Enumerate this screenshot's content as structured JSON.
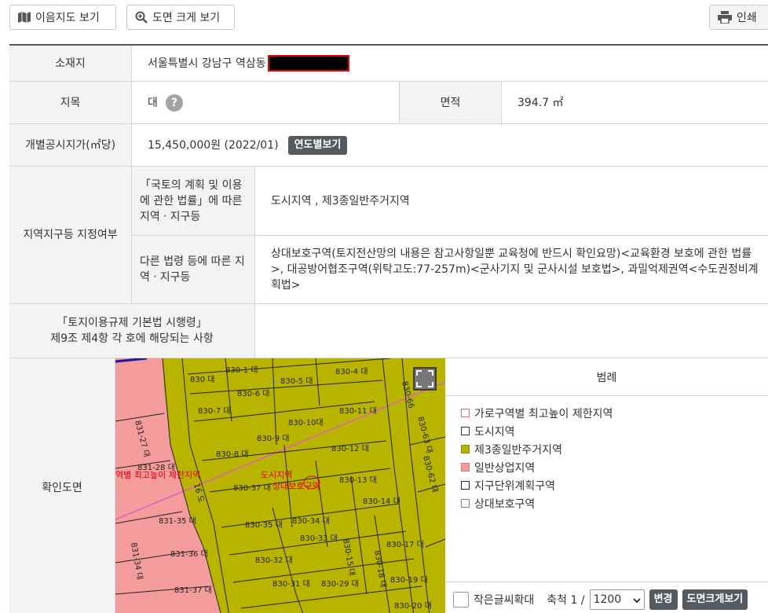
{
  "toolbar": {
    "map_label": "이음지도 보기",
    "zoom_label": "도면 크게 보기",
    "print_label": "인쇄"
  },
  "info": {
    "location": {
      "label": "소재지",
      "value": "서울특별시 강남구 역삼동"
    },
    "land_category": {
      "label": "지목",
      "value": "대",
      "help": "?"
    },
    "area": {
      "label": "면적",
      "value": "394.7 ㎡"
    },
    "official_price": {
      "label": "개별공시지가(㎡당)",
      "value": "15,450,000원 (2022/01)",
      "button": "연도별보기"
    },
    "zoning": {
      "label": "지역지구등 지정여부",
      "sub1_label": "「국토의 계획 및 이용에 관한 법률」에 따른 지역ㆍ지구등",
      "sub1_value": "도시지역 , 제3종일반주거지역",
      "sub2_label": "다른 법령 등에 따른 지역ㆍ지구등",
      "sub2_value": "상대보호구역(토지전산망의 내용은 참고사항일뿐 교육청에 반드시 확인요망)<교육환경 보호에 관한 법률>, 대공방어협조구역(위탁고도:77-257m)<군사기지 및 군사시설 보호법>, 과밀억제권역<수도권정비계획법>"
    },
    "regulation": {
      "label_line1": "「토지이용규제 기본법 시행령」",
      "label_line2": "제9조 제4항 각 호에 해당되는 사항",
      "value": ""
    },
    "map": {
      "label": "확인도면"
    }
  },
  "map_labels": {
    "parcels": [
      "830-1 대",
      "830-4 대",
      "830 대",
      "830-5 대",
      "830-6 대",
      "830-7 대",
      "830-10대",
      "830-11 대",
      "830-9 대",
      "830-8 대",
      "830-12 대",
      "830-13 대",
      "830-37 대",
      "830-35 대",
      "830-34 대",
      "830-33 대",
      "830-32 대",
      "830-31 대",
      "830-29 대",
      "830-14 대",
      "830-17 대",
      "830-19 대",
      "830-20 대",
      "831-27 대",
      "831-28 대",
      "831-35 대",
      "831-36 대",
      "831-34 대",
      "831-37 대",
      "16 도",
      "830-66",
      "830-63 대",
      "830-62 대",
      "830-18 대",
      "830-15 대"
    ],
    "zone_red_1": "역별 최고높이 제한지역",
    "zone_red_2": "도시지역",
    "zone_red_3": "상대보호구역"
  },
  "legend": {
    "title": "범례",
    "items": [
      {
        "label": "가로구역별 최고높이 제한지역",
        "color": "#e060c0",
        "fill": "#ffffff"
      },
      {
        "label": "도시지역",
        "color": "#333333",
        "fill": "#ffffff"
      },
      {
        "label": "제3종일반주거지역",
        "color": "#b8b400",
        "fill": "#b8b400"
      },
      {
        "label": "일반상업지역",
        "color": "#f49b9b",
        "fill": "#f49b9b"
      },
      {
        "label": "지구단위계획구역",
        "color": "#1a1aa0",
        "fill": "#ffffff"
      },
      {
        "label": "상대보호구역",
        "color": "#c060c0",
        "fill": "#ffffff"
      }
    ],
    "small_text_label": "작은글씨확대",
    "scale_label": "축척 1 /",
    "scale_value": "1200",
    "change_button": "변경",
    "enlarge_button": "도면크게보기"
  },
  "colors": {
    "residential": "#b8b400",
    "commercial": "#f49b9b",
    "header_bg": "#f3f3f3",
    "button_dark": "#555a60"
  }
}
